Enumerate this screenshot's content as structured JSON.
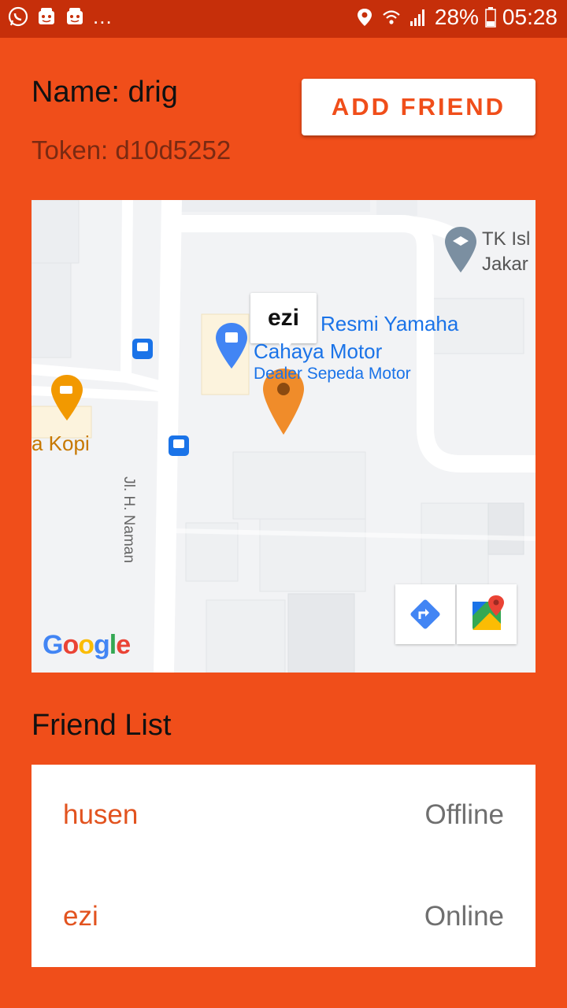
{
  "status_bar": {
    "left_icons": [
      "whatsapp-icon",
      "app-notification-icon",
      "app-notification-icon"
    ],
    "more": "...",
    "battery": "28%",
    "time": "05:28",
    "icons": [
      "location-icon",
      "wifi-icon",
      "signal-icon",
      "battery-icon"
    ]
  },
  "profile": {
    "name": "Name: drig",
    "token": "Token: d10d5252"
  },
  "add_friend_label": "ADD FRIEND",
  "map": {
    "marker_label": "ezi",
    "places": {
      "dealer_line1": "Resmi Yamaha",
      "dealer_line2": "Cahaya Motor",
      "dealer_category": "Dealer Sepeda Motor",
      "school_line1": "TK Isl",
      "school_line2": "Jakar",
      "cafe": "a Kopi",
      "street": "Jl. H. Naman"
    },
    "brand": "Google",
    "colors": {
      "marker": "#F08C2A",
      "poi_blue": "#4285F4",
      "label_blue": "#1A73E8"
    }
  },
  "friend_list": {
    "title": "Friend List",
    "friends": [
      {
        "name": "husen",
        "status": "Offline"
      },
      {
        "name": "ezi",
        "status": "Online"
      }
    ]
  },
  "colors": {
    "background": "#F04E1A",
    "status_bar": "#C62F0A",
    "accent": "#F04E1A"
  }
}
